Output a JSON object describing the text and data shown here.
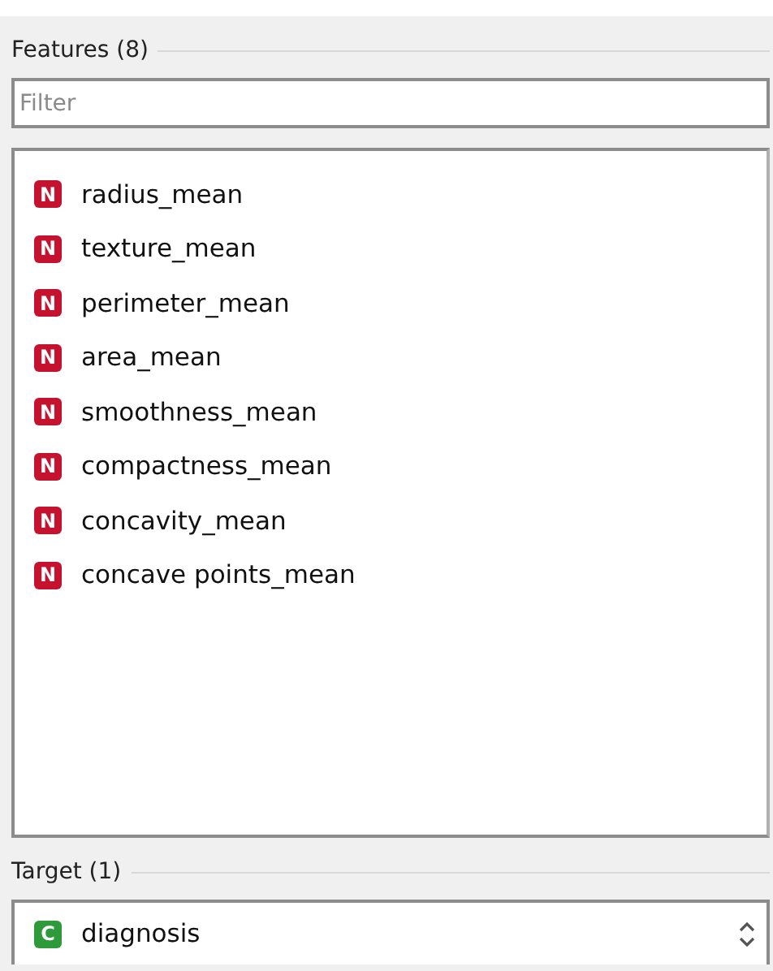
{
  "features": {
    "title": "Features (8)",
    "filter": {
      "placeholder": "Filter"
    },
    "items": [
      {
        "icon": "N",
        "kind": "numeric",
        "name": "radius_mean"
      },
      {
        "icon": "N",
        "kind": "numeric",
        "name": "texture_mean"
      },
      {
        "icon": "N",
        "kind": "numeric",
        "name": "perimeter_mean"
      },
      {
        "icon": "N",
        "kind": "numeric",
        "name": "area_mean"
      },
      {
        "icon": "N",
        "kind": "numeric",
        "name": "smoothness_mean"
      },
      {
        "icon": "N",
        "kind": "numeric",
        "name": "compactness_mean"
      },
      {
        "icon": "N",
        "kind": "numeric",
        "name": "concavity_mean"
      },
      {
        "icon": "N",
        "kind": "numeric",
        "name": "concave points_mean"
      }
    ]
  },
  "target": {
    "title": "Target (1)",
    "value": {
      "icon": "C",
      "kind": "categorical",
      "name": "diagnosis"
    }
  }
}
